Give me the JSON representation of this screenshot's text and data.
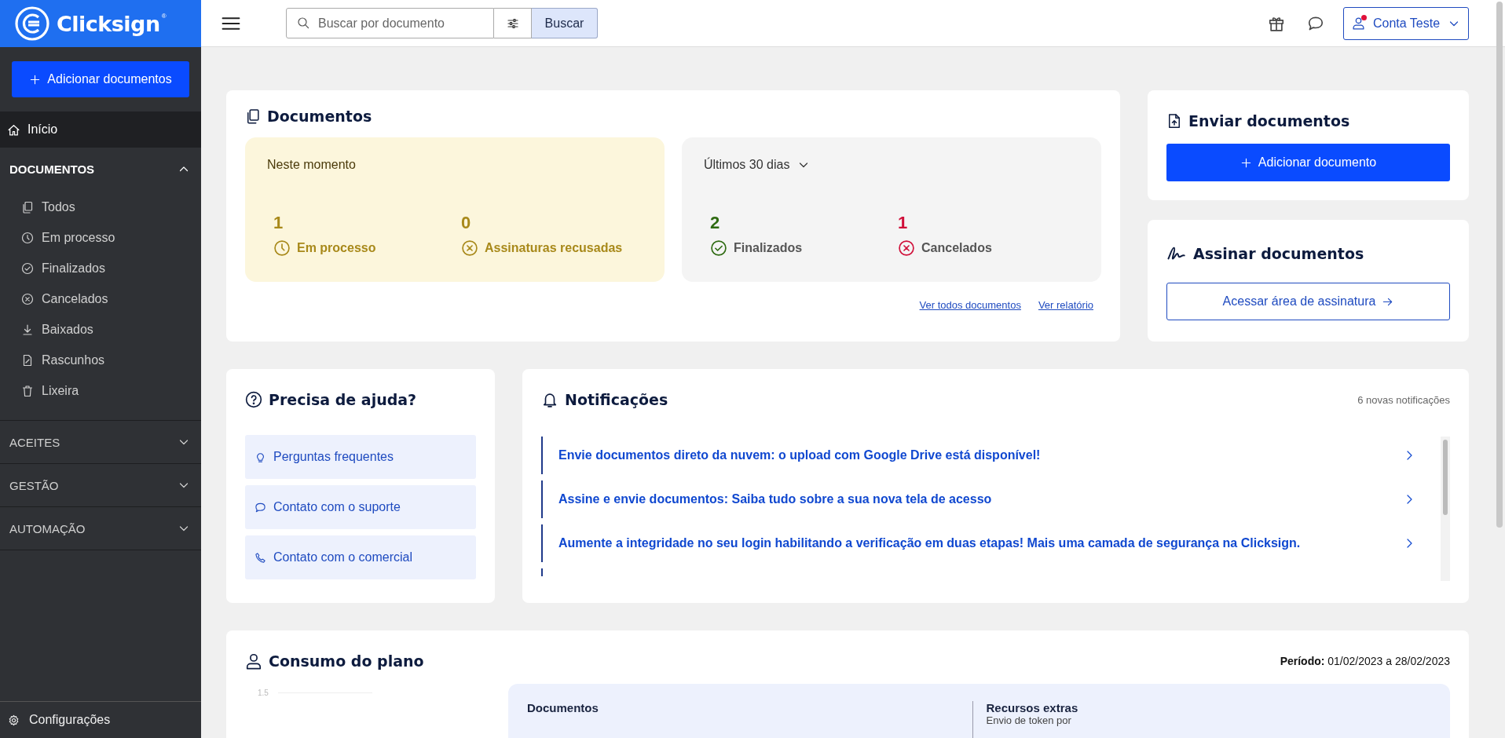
{
  "brand": {
    "name": "Clicksign",
    "mark": "®"
  },
  "sidebar": {
    "add_button": "Adicionar documentos",
    "home": {
      "label": "Início",
      "selected": true
    },
    "sections": [
      {
        "title": "DOCUMENTOS",
        "expanded": true,
        "items": [
          "Todos",
          "Em processo",
          "Finalizados",
          "Cancelados",
          "Baixados",
          "Rascunhos",
          "Lixeira"
        ]
      },
      {
        "title": "ACEITES",
        "expanded": false
      },
      {
        "title": "GESTÃO",
        "expanded": false
      },
      {
        "title": "AUTOMAÇÃO",
        "expanded": false
      }
    ],
    "settings": "Configurações"
  },
  "topbar": {
    "search": {
      "placeholder": "Buscar por documento"
    },
    "search_button": "Buscar",
    "account": {
      "name": "Conta Teste",
      "has_alert": true
    }
  },
  "documents": {
    "title": "Documentos",
    "now": {
      "title": "Neste momento",
      "stats": [
        {
          "kind": "pending",
          "value": "1",
          "label": "Em processo",
          "color": "#a8891a"
        },
        {
          "kind": "refused",
          "value": "0",
          "label": "Assinaturas recusadas",
          "color": "#a8891a"
        }
      ]
    },
    "recent": {
      "title": "Últimos 30 dias",
      "stats": [
        {
          "kind": "done",
          "value": "2",
          "label": "Finalizados",
          "color": "#2f6b12"
        },
        {
          "kind": "canceled",
          "value": "1",
          "label": "Cancelados",
          "color": "#d0103a"
        }
      ]
    },
    "links": [
      "Ver todos documentos",
      "Ver relatório"
    ]
  },
  "send": {
    "title": "Enviar documentos",
    "button": "Adicionar documento"
  },
  "sign": {
    "title": "Assinar documentos",
    "button": "Acessar área de assinatura"
  },
  "help": {
    "title": "Precisa de ajuda?",
    "items": [
      "Perguntas frequentes",
      "Contato com o suporte",
      "Contato com o comercial"
    ]
  },
  "notifications": {
    "title": "Notificações",
    "count": "6 novas notificações",
    "items": [
      "Envie documentos direto da nuvem: o upload com Google Drive está disponível!",
      "Assine e envie documentos: Saiba tudo sobre a sua nova tela de acesso",
      "Aumente a integridade no seu login habilitando a verificação em duas etapas! Mais uma camada de segurança na Clicksign."
    ]
  },
  "plan": {
    "title": "Consumo do plano",
    "period_label": "Período:",
    "period": "01/02/2023 a 28/02/2023",
    "chart_tick": "1.5",
    "columns": [
      {
        "title": "Documentos"
      },
      {
        "title": "Recursos extras",
        "text": "Envio de token por"
      }
    ]
  }
}
